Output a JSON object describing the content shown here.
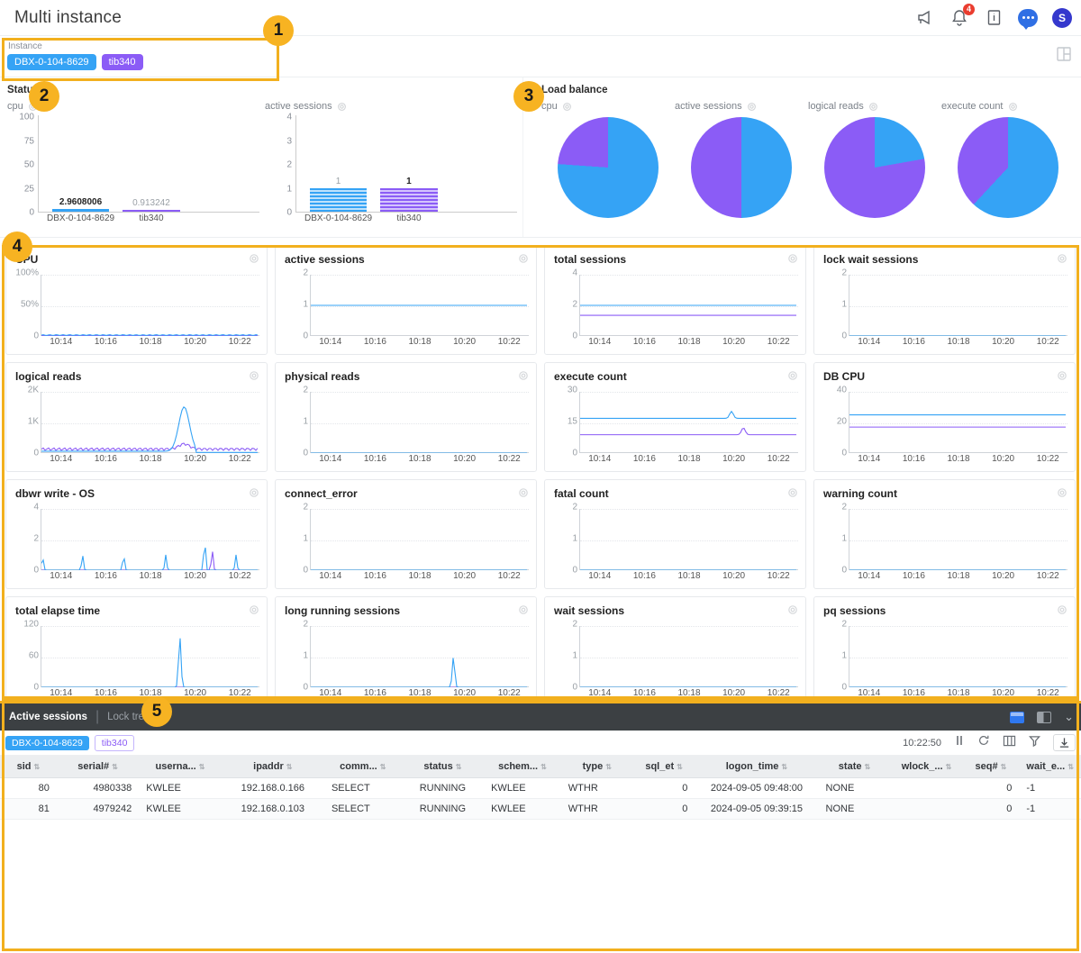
{
  "header": {
    "title": "Multi instance",
    "icons": [
      {
        "name": "megaphone-icon"
      },
      {
        "name": "bell-icon",
        "badge": "4"
      },
      {
        "name": "info-box-icon"
      },
      {
        "name": "chat-icon"
      },
      {
        "name": "user-avatar",
        "label": "S"
      }
    ]
  },
  "filter": {
    "label": "Instance",
    "tags": [
      {
        "text": "DBX-0-104-8629",
        "color": "#35a3f5"
      },
      {
        "text": "tib340",
        "color": "#8b5cf6"
      }
    ],
    "layout_icon": "layout-grid-icon"
  },
  "status": {
    "title": "Status",
    "charts": [
      {
        "name": "cpu",
        "chart_data": {
          "type": "bar",
          "title": "cpu",
          "categories": [
            "DBX-0-104-8629",
            "tib340"
          ],
          "values": [
            2.9608006,
            0.913242
          ],
          "value_labels": [
            "2.9608006",
            "0.913242"
          ],
          "colors": [
            "#35a3f5",
            "#8b5cf6"
          ],
          "yticks": [
            "0",
            "25",
            "50",
            "75",
            "100"
          ],
          "ylim": [
            0,
            100
          ],
          "grid": false
        }
      },
      {
        "name": "active sessions",
        "chart_data": {
          "type": "bar",
          "title": "active sessions",
          "categories": [
            "DBX-0-104-8629",
            "tib340"
          ],
          "values": [
            1,
            1
          ],
          "value_labels": [
            "1",
            "1"
          ],
          "colors": [
            "#35a3f5",
            "#8b5cf6"
          ],
          "yticks": [
            "0",
            "1",
            "2",
            "3",
            "4"
          ],
          "ylim": [
            0,
            4
          ],
          "grid": false
        }
      }
    ]
  },
  "load_balance": {
    "title": "Load balance",
    "charts": [
      {
        "name": "cpu",
        "chart_data": {
          "type": "pie",
          "title": "cpu",
          "labels": [
            "DBX-0-104-8629",
            "tib340"
          ],
          "values": [
            76,
            24
          ],
          "colors": [
            "#35a3f5",
            "#8b5cf6"
          ]
        }
      },
      {
        "name": "active sessions",
        "chart_data": {
          "type": "pie",
          "title": "active sessions",
          "labels": [
            "DBX-0-104-8629",
            "tib340"
          ],
          "values": [
            50,
            50
          ],
          "colors": [
            "#35a3f5",
            "#8b5cf6"
          ]
        }
      },
      {
        "name": "logical reads",
        "chart_data": {
          "type": "pie",
          "title": "logical reads",
          "labels": [
            "DBX-0-104-8629",
            "tib340"
          ],
          "values": [
            22,
            78
          ],
          "colors": [
            "#35a3f5",
            "#8b5cf6"
          ]
        }
      },
      {
        "name": "execute count",
        "chart_data": {
          "type": "pie",
          "title": "execute count",
          "labels": [
            "DBX-0-104-8629",
            "tib340"
          ],
          "values": [
            62,
            38
          ],
          "colors": [
            "#35a3f5",
            "#8b5cf6"
          ]
        }
      }
    ]
  },
  "metrics": {
    "xticks": [
      "10:14",
      "10:16",
      "10:18",
      "10:20",
      "10:22"
    ],
    "series_colors": {
      "DBX-0-104-8629": "#35a3f5",
      "tib340": "#8b5cf6"
    },
    "cards": [
      {
        "title": "CPU",
        "yticks": [
          "0",
          "50%",
          "100%"
        ],
        "ylim": [
          0,
          100
        ],
        "blue": 1.5,
        "purple": 0.6,
        "shape": "noise"
      },
      {
        "title": "active sessions",
        "yticks": [
          "0",
          "1",
          "2"
        ],
        "ylim": [
          0,
          2
        ],
        "blue": 1,
        "purple": 1,
        "shape": "flat"
      },
      {
        "title": "total sessions",
        "yticks": [
          "0",
          "2",
          "4"
        ],
        "ylim": [
          0,
          4
        ],
        "blue": 2,
        "purple": 1.35,
        "shape": "flat"
      },
      {
        "title": "lock wait sessions",
        "yticks": [
          "0",
          "1",
          "2"
        ],
        "ylim": [
          0,
          2
        ],
        "blue": 0,
        "purple": 0,
        "shape": "flat"
      },
      {
        "title": "logical reads",
        "yticks": [
          "0",
          "1K",
          "2K"
        ],
        "ylim": [
          0,
          2000
        ],
        "blue": 60,
        "purple": 130,
        "shape": "spike-big"
      },
      {
        "title": "physical reads",
        "yticks": [
          "0",
          "1",
          "2"
        ],
        "ylim": [
          0,
          2
        ],
        "blue": 0,
        "purple": 0,
        "shape": "flat"
      },
      {
        "title": "execute count",
        "yticks": [
          "0",
          "15",
          "30"
        ],
        "ylim": [
          0,
          30
        ],
        "blue": 17,
        "purple": 9,
        "shape": "spike-small"
      },
      {
        "title": "DB CPU",
        "yticks": [
          "0",
          "20",
          "40"
        ],
        "ylim": [
          0,
          40
        ],
        "blue": 25,
        "purple": 17,
        "shape": "flat"
      },
      {
        "title": "dbwr write - OS",
        "yticks": [
          "0",
          "2",
          "4"
        ],
        "ylim": [
          0,
          4
        ],
        "blue": 0,
        "purple": 0,
        "shape": "pulses"
      },
      {
        "title": "connect_error",
        "yticks": [
          "0",
          "1",
          "2"
        ],
        "ylim": [
          0,
          2
        ],
        "blue": 0,
        "purple": 0,
        "shape": "flat"
      },
      {
        "title": "fatal count",
        "yticks": [
          "0",
          "1",
          "2"
        ],
        "ylim": [
          0,
          2
        ],
        "blue": 0,
        "purple": 0,
        "shape": "flat"
      },
      {
        "title": "warning count",
        "yticks": [
          "0",
          "1",
          "2"
        ],
        "ylim": [
          0,
          2
        ],
        "blue": 0,
        "purple": 0,
        "shape": "flat"
      },
      {
        "title": "total elapse time",
        "yticks": [
          "0",
          "60",
          "120"
        ],
        "ylim": [
          0,
          120
        ],
        "blue": 0,
        "purple": 0,
        "shape": "one-spike"
      },
      {
        "title": "long running sessions",
        "yticks": [
          "0",
          "1",
          "2"
        ],
        "ylim": [
          0,
          2
        ],
        "blue": 0,
        "purple": 0,
        "shape": "one-spike-1"
      },
      {
        "title": "wait sessions",
        "yticks": [
          "0",
          "1",
          "2"
        ],
        "ylim": [
          0,
          2
        ],
        "blue": 0,
        "purple": 0,
        "shape": "flat"
      },
      {
        "title": "pq sessions",
        "yticks": [
          "0",
          "1",
          "2"
        ],
        "ylim": [
          0,
          2
        ],
        "blue": 0,
        "purple": 0,
        "shape": "flat"
      }
    ]
  },
  "bottom_panel": {
    "tabs": [
      {
        "label": "Active sessions",
        "active": true
      },
      {
        "label": "Lock tree",
        "active": false
      }
    ],
    "view_icons": [
      "layout-bottom-icon",
      "layout-split-icon",
      "chevron-down-icon"
    ],
    "tags": [
      {
        "text": "DBX-0-104-8629",
        "style": "blue"
      },
      {
        "text": "tib340",
        "style": "purple"
      }
    ],
    "timestamp": "10:22:50",
    "toolbar_icons": [
      "pause-icon",
      "refresh-icon",
      "columns-icon",
      "filter-icon",
      "download-icon"
    ],
    "columns": [
      {
        "key": "sid",
        "label": "sid",
        "align": "right",
        "width": "5.5%"
      },
      {
        "key": "serial",
        "label": "serial#",
        "align": "right",
        "width": "8%"
      },
      {
        "key": "username",
        "label": "userna...",
        "align": "left",
        "width": "8%"
      },
      {
        "key": "ipaddr",
        "label": "ipaddr",
        "align": "center",
        "width": "10%"
      },
      {
        "key": "command",
        "label": "comm...",
        "align": "left",
        "width": "7.5%"
      },
      {
        "key": "status",
        "label": "status",
        "align": "center",
        "width": "8%"
      },
      {
        "key": "schema",
        "label": "schem...",
        "align": "left",
        "width": "7.5%"
      },
      {
        "key": "type",
        "label": "type",
        "align": "left",
        "width": "7%"
      },
      {
        "key": "sql_et",
        "label": "sql_et",
        "align": "right",
        "width": "6%"
      },
      {
        "key": "logon_time",
        "label": "logon_time",
        "align": "center",
        "width": "12%"
      },
      {
        "key": "state",
        "label": "state",
        "align": "left",
        "width": "7%"
      },
      {
        "key": "wlock",
        "label": "wlock_...",
        "align": "left",
        "width": "7%"
      },
      {
        "key": "seq",
        "label": "seq#",
        "align": "right",
        "width": "5.5%"
      },
      {
        "key": "wait_e",
        "label": "wait_e...",
        "align": "left",
        "width": "6%"
      }
    ],
    "rows": [
      {
        "sid": "80",
        "serial": "4980338",
        "username": "KWLEE",
        "ipaddr": "192.168.0.166",
        "command": "SELECT",
        "status": "RUNNING",
        "schema": "KWLEE",
        "type": "WTHR",
        "sql_et": "0",
        "logon_time": "2024-09-05 09:48:00",
        "state": "NONE",
        "wlock": "",
        "seq": "0",
        "wait_e": "-1"
      },
      {
        "sid": "81",
        "serial": "4979242",
        "username": "KWLEE",
        "ipaddr": "192.168.0.103",
        "command": "SELECT",
        "status": "RUNNING",
        "schema": "KWLEE",
        "type": "WTHR",
        "sql_et": "0",
        "logon_time": "2024-09-05 09:39:15",
        "state": "NONE",
        "wlock": "",
        "seq": "0",
        "wait_e": "-1"
      }
    ]
  },
  "callouts": [
    {
      "number": "1"
    },
    {
      "number": "2"
    },
    {
      "number": "3"
    },
    {
      "number": "4"
    },
    {
      "number": "5"
    }
  ],
  "accent_color": "#f2b01e"
}
